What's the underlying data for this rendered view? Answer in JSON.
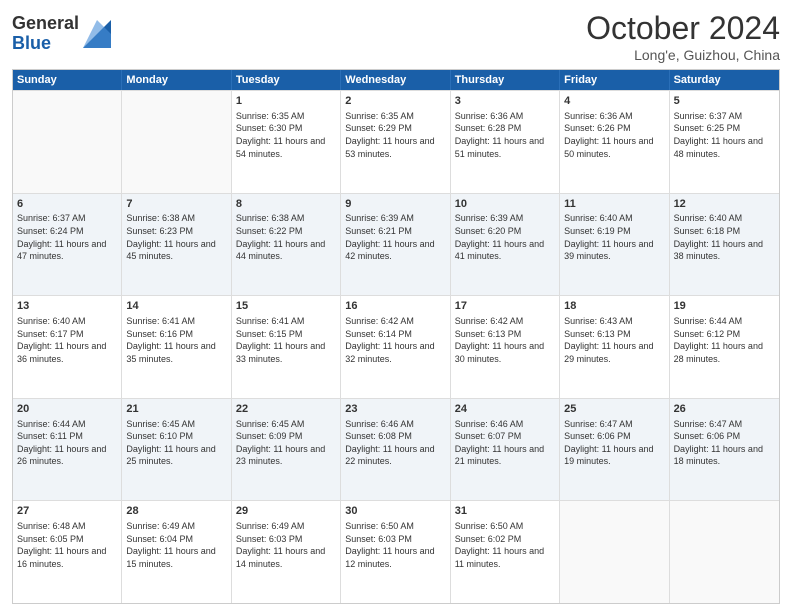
{
  "header": {
    "logo_general": "General",
    "logo_blue": "Blue",
    "month_title": "October 2024",
    "location": "Long'e, Guizhou, China"
  },
  "weekdays": [
    "Sunday",
    "Monday",
    "Tuesday",
    "Wednesday",
    "Thursday",
    "Friday",
    "Saturday"
  ],
  "weeks": [
    [
      {
        "day": "",
        "empty": true
      },
      {
        "day": "",
        "empty": true
      },
      {
        "day": "1",
        "rise": "6:35 AM",
        "set": "6:30 PM",
        "daylight": "11 hours and 54 minutes."
      },
      {
        "day": "2",
        "rise": "6:35 AM",
        "set": "6:29 PM",
        "daylight": "11 hours and 53 minutes."
      },
      {
        "day": "3",
        "rise": "6:36 AM",
        "set": "6:28 PM",
        "daylight": "11 hours and 51 minutes."
      },
      {
        "day": "4",
        "rise": "6:36 AM",
        "set": "6:26 PM",
        "daylight": "11 hours and 50 minutes."
      },
      {
        "day": "5",
        "rise": "6:37 AM",
        "set": "6:25 PM",
        "daylight": "11 hours and 48 minutes."
      }
    ],
    [
      {
        "day": "6",
        "rise": "6:37 AM",
        "set": "6:24 PM",
        "daylight": "11 hours and 47 minutes."
      },
      {
        "day": "7",
        "rise": "6:38 AM",
        "set": "6:23 PM",
        "daylight": "11 hours and 45 minutes."
      },
      {
        "day": "8",
        "rise": "6:38 AM",
        "set": "6:22 PM",
        "daylight": "11 hours and 44 minutes."
      },
      {
        "day": "9",
        "rise": "6:39 AM",
        "set": "6:21 PM",
        "daylight": "11 hours and 42 minutes."
      },
      {
        "day": "10",
        "rise": "6:39 AM",
        "set": "6:20 PM",
        "daylight": "11 hours and 41 minutes."
      },
      {
        "day": "11",
        "rise": "6:40 AM",
        "set": "6:19 PM",
        "daylight": "11 hours and 39 minutes."
      },
      {
        "day": "12",
        "rise": "6:40 AM",
        "set": "6:18 PM",
        "daylight": "11 hours and 38 minutes."
      }
    ],
    [
      {
        "day": "13",
        "rise": "6:40 AM",
        "set": "6:17 PM",
        "daylight": "11 hours and 36 minutes."
      },
      {
        "day": "14",
        "rise": "6:41 AM",
        "set": "6:16 PM",
        "daylight": "11 hours and 35 minutes."
      },
      {
        "day": "15",
        "rise": "6:41 AM",
        "set": "6:15 PM",
        "daylight": "11 hours and 33 minutes."
      },
      {
        "day": "16",
        "rise": "6:42 AM",
        "set": "6:14 PM",
        "daylight": "11 hours and 32 minutes."
      },
      {
        "day": "17",
        "rise": "6:42 AM",
        "set": "6:13 PM",
        "daylight": "11 hours and 30 minutes."
      },
      {
        "day": "18",
        "rise": "6:43 AM",
        "set": "6:13 PM",
        "daylight": "11 hours and 29 minutes."
      },
      {
        "day": "19",
        "rise": "6:44 AM",
        "set": "6:12 PM",
        "daylight": "11 hours and 28 minutes."
      }
    ],
    [
      {
        "day": "20",
        "rise": "6:44 AM",
        "set": "6:11 PM",
        "daylight": "11 hours and 26 minutes."
      },
      {
        "day": "21",
        "rise": "6:45 AM",
        "set": "6:10 PM",
        "daylight": "11 hours and 25 minutes."
      },
      {
        "day": "22",
        "rise": "6:45 AM",
        "set": "6:09 PM",
        "daylight": "11 hours and 23 minutes."
      },
      {
        "day": "23",
        "rise": "6:46 AM",
        "set": "6:08 PM",
        "daylight": "11 hours and 22 minutes."
      },
      {
        "day": "24",
        "rise": "6:46 AM",
        "set": "6:07 PM",
        "daylight": "11 hours and 21 minutes."
      },
      {
        "day": "25",
        "rise": "6:47 AM",
        "set": "6:06 PM",
        "daylight": "11 hours and 19 minutes."
      },
      {
        "day": "26",
        "rise": "6:47 AM",
        "set": "6:06 PM",
        "daylight": "11 hours and 18 minutes."
      }
    ],
    [
      {
        "day": "27",
        "rise": "6:48 AM",
        "set": "6:05 PM",
        "daylight": "11 hours and 16 minutes."
      },
      {
        "day": "28",
        "rise": "6:49 AM",
        "set": "6:04 PM",
        "daylight": "11 hours and 15 minutes."
      },
      {
        "day": "29",
        "rise": "6:49 AM",
        "set": "6:03 PM",
        "daylight": "11 hours and 14 minutes."
      },
      {
        "day": "30",
        "rise": "6:50 AM",
        "set": "6:03 PM",
        "daylight": "11 hours and 12 minutes."
      },
      {
        "day": "31",
        "rise": "6:50 AM",
        "set": "6:02 PM",
        "daylight": "11 hours and 11 minutes."
      },
      {
        "day": "",
        "empty": true
      },
      {
        "day": "",
        "empty": true
      }
    ]
  ]
}
